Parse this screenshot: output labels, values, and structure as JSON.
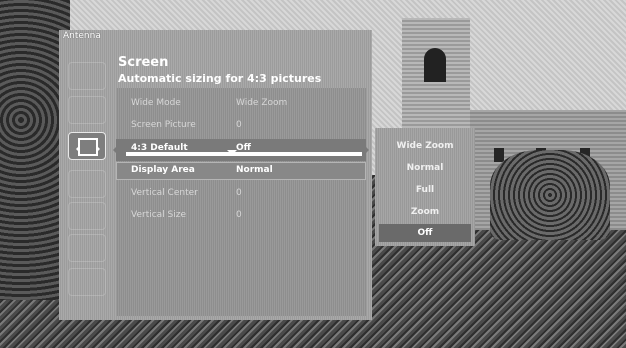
{
  "header": {
    "source": "Antenna",
    "title": "Screen",
    "subtitle": "Automatic sizing for 4:3 pictures"
  },
  "settings": [
    {
      "label": "Wide Mode",
      "value": "Wide Zoom"
    },
    {
      "label": "Screen Picture",
      "value": "0"
    },
    {
      "label": "4:3 Default",
      "value": "Off"
    },
    {
      "label": "Display Area",
      "value": "Normal"
    },
    {
      "label": "Vertical Center",
      "value": "0"
    },
    {
      "label": "Vertical Size",
      "value": "0"
    }
  ],
  "popup_options": [
    "Wide Zoom",
    "Normal",
    "Full",
    "Zoom",
    "Off"
  ],
  "selected_option": "Off",
  "side_icons": [
    "picture-icon",
    "sound-icon",
    "screen-icon",
    "channel-icon",
    "setup-icon",
    "parental-icon",
    "extras-icon"
  ],
  "colors": {
    "highlight": "#7a7a7a",
    "panel": "#a3a3a3",
    "text": "#ffffff"
  }
}
